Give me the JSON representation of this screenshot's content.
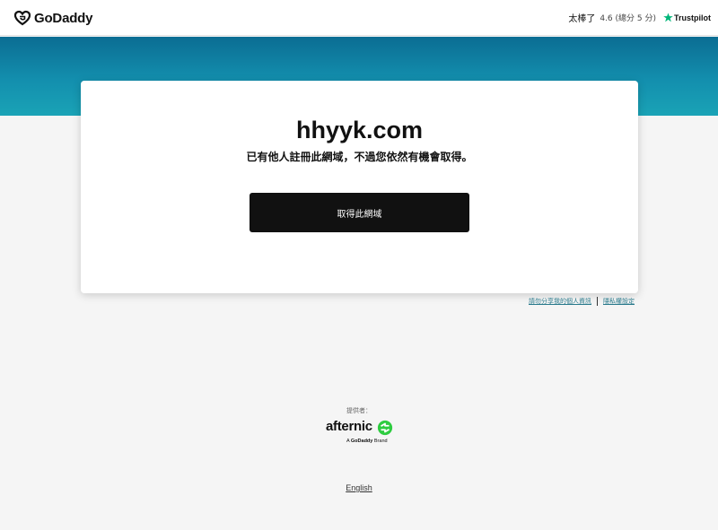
{
  "header": {
    "logo_text": "GoDaddy",
    "rating_label": "太棒了",
    "rating_score": "4.6 (總分 5 分)",
    "trustpilot": "Trustpilot"
  },
  "card": {
    "domain": "hhyyk.com",
    "subtitle": "已有他人註冊此網域，不過您依然有機會取得。",
    "cta_label": "取得此網域"
  },
  "links": {
    "privacy_share": "請勿分享我的個人資訊",
    "privacy_settings": "隱私權設定"
  },
  "provider": {
    "label": "提供者：",
    "brand": "afternic",
    "brand_prefix": "A",
    "brand_parent": "GoDaddy",
    "brand_suffix": "Brand"
  },
  "footer": {
    "language": "English"
  },
  "colors": {
    "band_top": "#0b6d93",
    "band_bottom": "#1aa3b6",
    "cta_bg": "#111111",
    "trustpilot_green": "#00b67a",
    "afternic_green": "#2ecc40",
    "link": "#2a7a8c"
  }
}
